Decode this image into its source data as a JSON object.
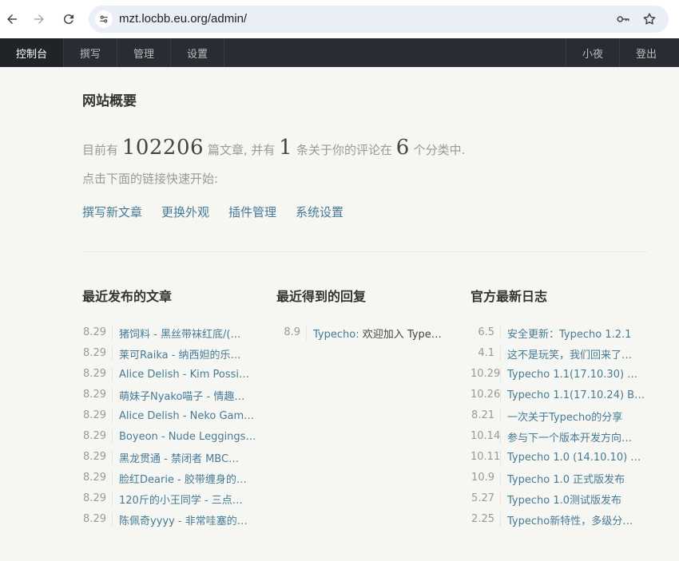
{
  "browser": {
    "url": "mzt.locbb.eu.org/admin/"
  },
  "nav": {
    "items": [
      "控制台",
      "撰写",
      "管理",
      "设置"
    ],
    "right": [
      "小夜",
      "登出"
    ]
  },
  "page": {
    "title": "网站概要",
    "summary": {
      "prefix": "目前有",
      "posts": "102206",
      "mid1": "篇文章, 并有",
      "comments": "1",
      "mid2": "条关于你的评论在",
      "categories": "6",
      "suffix": "个分类中."
    },
    "hint": "点击下面的链接快速开始:",
    "quick_links": [
      "撰写新文章",
      "更换外观",
      "插件管理",
      "系统设置"
    ]
  },
  "recent_posts": {
    "title": "最近发布的文章",
    "items": [
      {
        "date": "8.29",
        "title": "猪饲料 - 黑丝带袜红底/(…"
      },
      {
        "date": "8.29",
        "title": "莱可Raika - 纳西妲的乐…"
      },
      {
        "date": "8.29",
        "title": "Alice Delish - Kim Possi…"
      },
      {
        "date": "8.29",
        "title": "萌妹子Nyako喵子 - 情趣…"
      },
      {
        "date": "8.29",
        "title": "Alice Delish - Neko Gam…"
      },
      {
        "date": "8.29",
        "title": "Boyeon - Nude Leggings…"
      },
      {
        "date": "8.29",
        "title": "黑龙贯通 - 禁闭者 MBC…"
      },
      {
        "date": "8.29",
        "title": "脸红Dearie - 胶带缠身的…"
      },
      {
        "date": "8.29",
        "title": "120斤的小王同学 - 三点…"
      },
      {
        "date": "8.29",
        "title": "陈佩奇yyyy - 非常哇塞的…"
      }
    ]
  },
  "recent_comments": {
    "title": "最近得到的回复",
    "items": [
      {
        "date": "8.9",
        "author": "Typecho:",
        "text": "欢迎加入 Type…"
      }
    ]
  },
  "official_log": {
    "title": "官方最新日志",
    "items": [
      {
        "date": "6.5",
        "title": "安全更新：Typecho 1.2.1"
      },
      {
        "date": "4.1",
        "title": "这不是玩笑，我们回来了…"
      },
      {
        "date": "10.29",
        "title": "Typecho 1.1(17.10.30) …"
      },
      {
        "date": "10.26",
        "title": "Typecho 1.1(17.10.24) B…"
      },
      {
        "date": "8.21",
        "title": "一次关于Typecho的分享"
      },
      {
        "date": "10.14",
        "title": "参与下一个版本开发方向…"
      },
      {
        "date": "10.11",
        "title": "Typecho 1.0 (14.10.10) …"
      },
      {
        "date": "10.9",
        "title": "Typecho 1.0 正式版发布"
      },
      {
        "date": "5.27",
        "title": "Typecho 1.0测试版发布"
      },
      {
        "date": "2.25",
        "title": "Typecho新特性，多级分…"
      }
    ]
  }
}
